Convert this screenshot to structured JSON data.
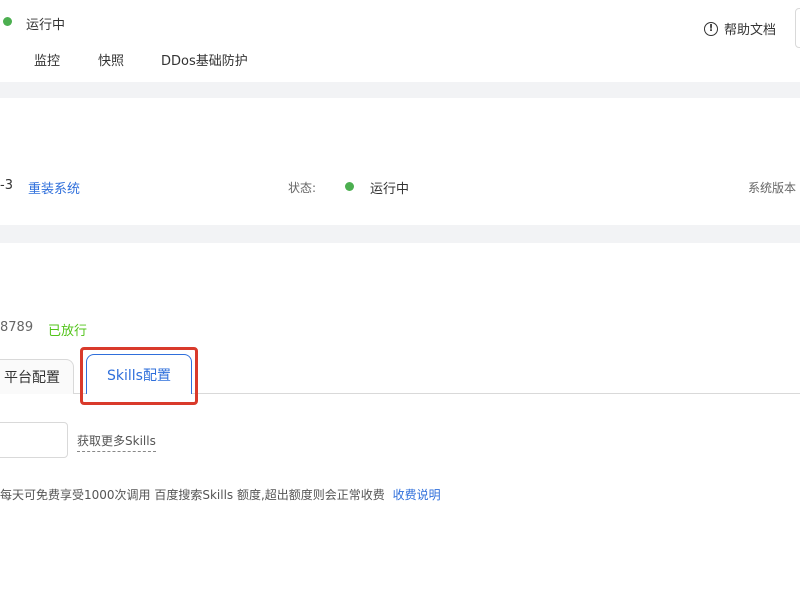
{
  "header": {
    "status_text": "运行中",
    "status_color": "#4caf50",
    "help_label": "帮助文档",
    "help_icon": "info-circle-icon",
    "tabs": [
      "监控",
      "快照",
      "DDos基础防护"
    ]
  },
  "instance": {
    "id_suffix": "-3",
    "reinstall_label": "重装系统",
    "status_label": "状态:",
    "status_value": "运行中",
    "system_version_label": "系统版本"
  },
  "port": {
    "value": "8789",
    "badge": "已放行",
    "badge_color": "#52c41a"
  },
  "config_tabs": {
    "platform_label": "平台配置",
    "skills_label": "Skills配置",
    "active": "Skills配置"
  },
  "skills": {
    "input_value": "",
    "more_skills_label": "获取更多Skills"
  },
  "notice": {
    "text": "每天可免费享受1000次调用 百度搜索Skills 额度,超出额度则会正常收费",
    "link_label": "收费说明"
  },
  "colors": {
    "accent": "#2f6fdb",
    "highlight": "#d93a2b"
  }
}
